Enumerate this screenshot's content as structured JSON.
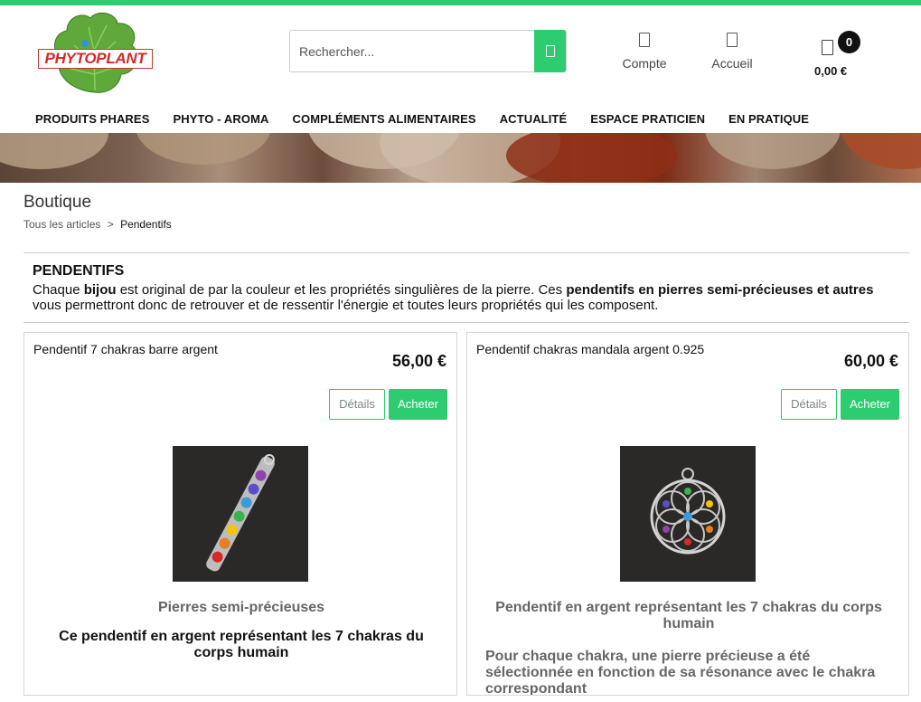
{
  "brand": {
    "logo_text": "PHYTOPLANT",
    "accent": "#2ecc71",
    "logo_red": "#d62828"
  },
  "search": {
    "placeholder": "Rechercher..."
  },
  "header": {
    "account_label": "Compte",
    "home_label": "Accueil",
    "cart_count": "0",
    "cart_total": "0,00 €"
  },
  "nav": {
    "items": [
      "PRODUITS PHARES",
      "PHYTO - AROMA",
      "COMPLÉMENTS ALIMENTAIRES",
      "ACTUALITÉ",
      "ESPACE PRATICIEN",
      "EN PRATIQUE"
    ]
  },
  "page": {
    "title": "Boutique",
    "breadcrumb": {
      "root": "Tous les articles",
      "separator": ">",
      "current": "Pendentifs"
    }
  },
  "category": {
    "title": "PENDENTIFS",
    "desc": {
      "p1": "Chaque ",
      "b1": "bijou",
      "p2": " est original de par la couleur et les propriétés singulières de la pierre. Ces ",
      "b2": "pendentifs en pierres semi-précieuses et autres",
      "p3": " vous permettront donc de retrouver et de ressentir l'énergie et toutes leurs propriétés qui les composent."
    }
  },
  "products": [
    {
      "name": "Pendentif 7 chakras barre argent",
      "price": "56,00 €",
      "details_label": "Détails",
      "buy_label": "Acheter",
      "subtitle": "Pierres semi-précieuses",
      "body": "Ce pendentif en argent représentant les 7 chakras du corps humain"
    },
    {
      "name": "Pendentif chakras mandala argent 0.925",
      "price": "60,00 €",
      "details_label": "Détails",
      "buy_label": "Acheter",
      "subtitle": "Pendentif en argent représentant les 7 chakras du corps humain",
      "body": "Pour chaque chakra, une pierre précieuse a été sélectionnée en fonction de sa résonance avec le chakra correspondant"
    }
  ]
}
